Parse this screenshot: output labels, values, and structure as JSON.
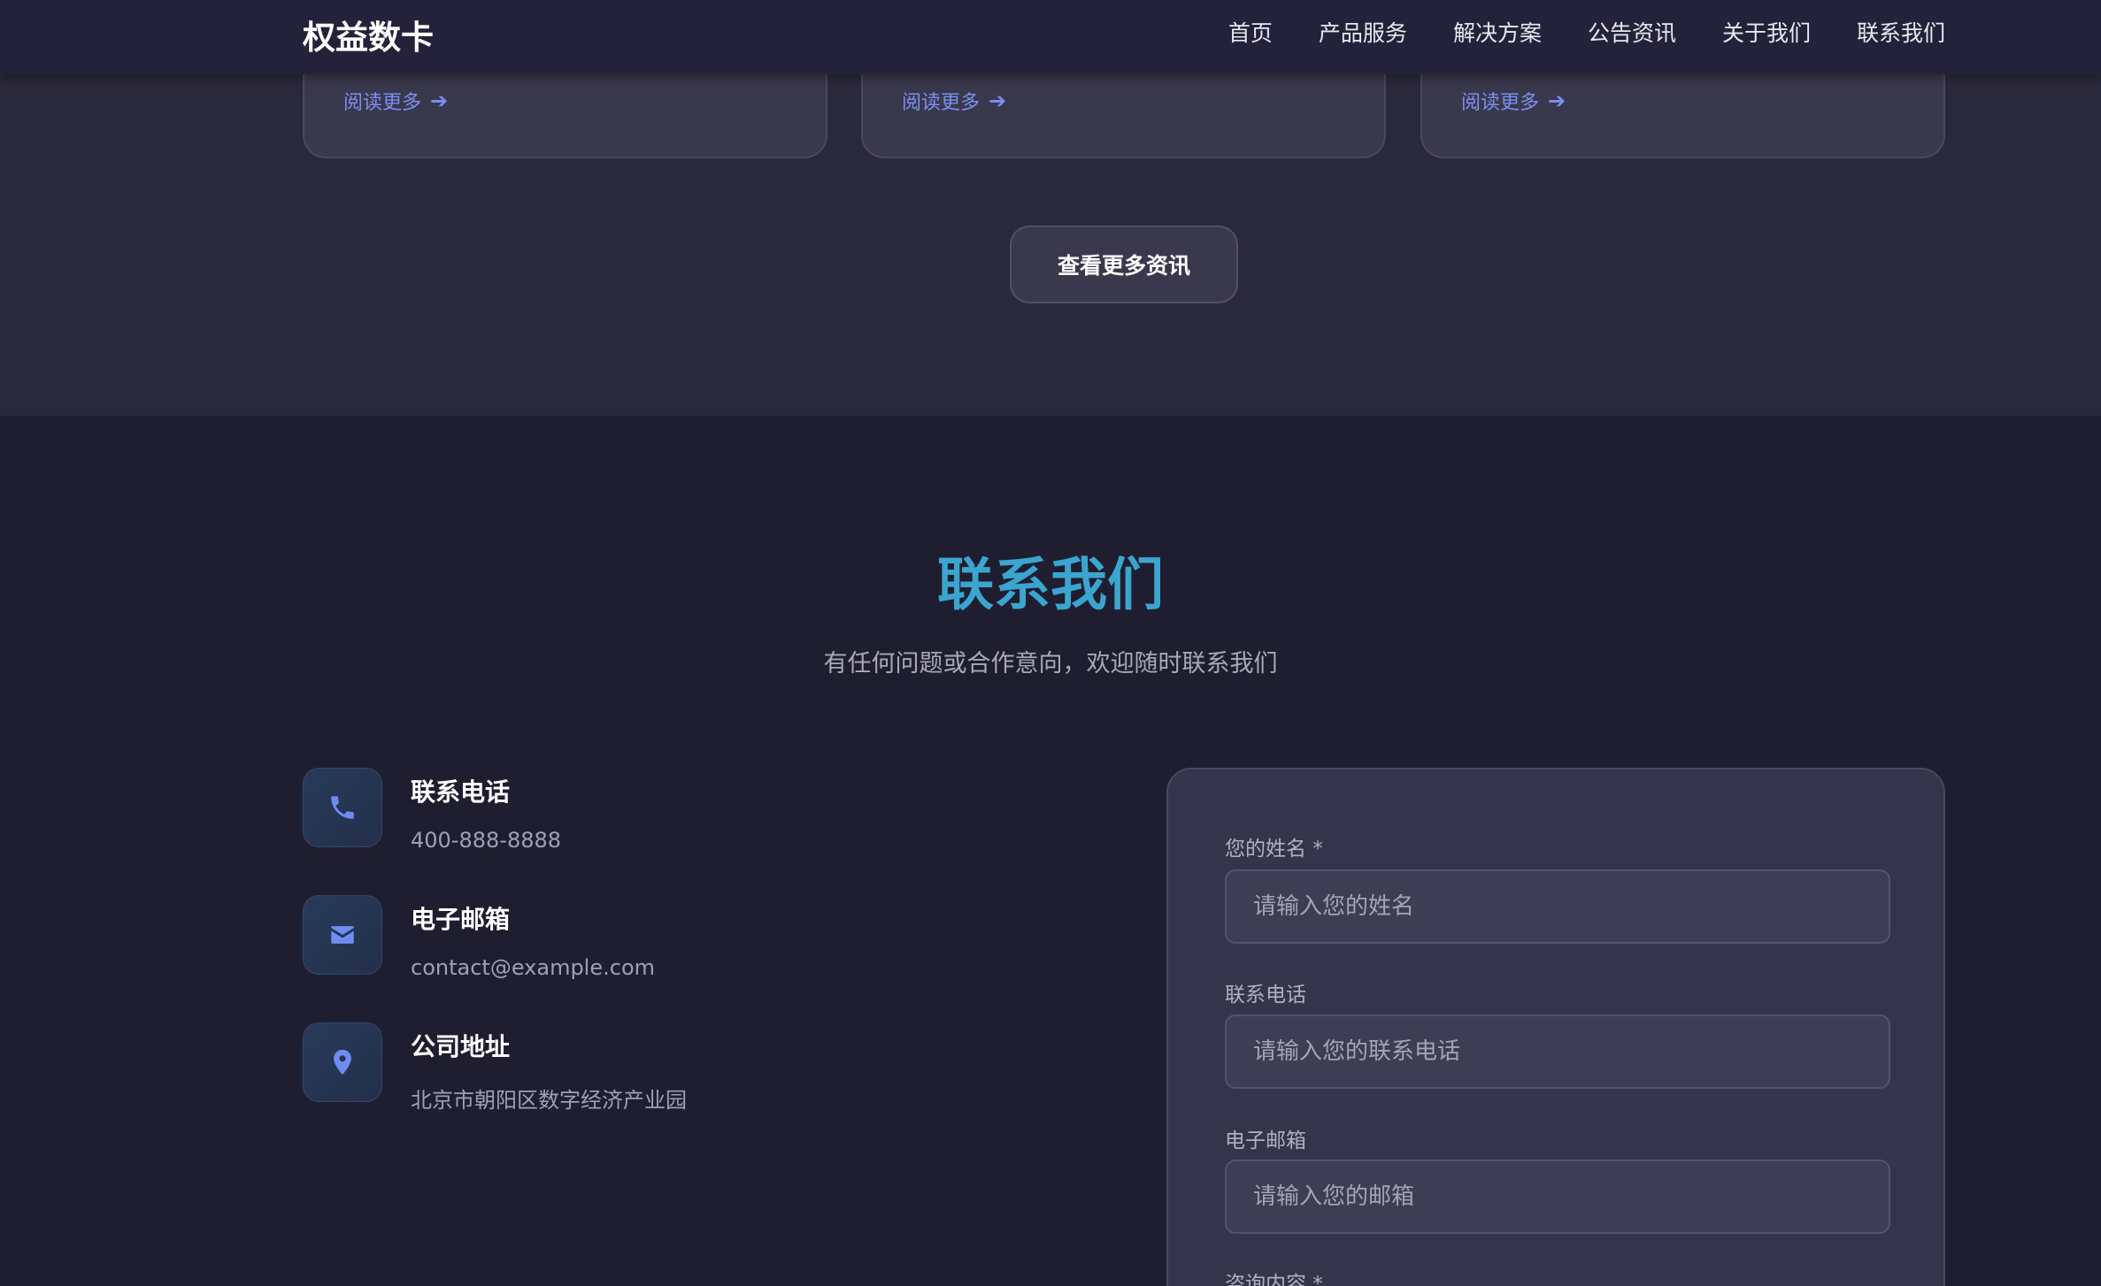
{
  "header": {
    "logo": "权益数卡",
    "nav": [
      "首页",
      "产品服务",
      "解决方案",
      "公告资讯",
      "关于我们",
      "联系我们"
    ]
  },
  "news": {
    "read_more": "阅读更多",
    "more_button": "查看更多资讯"
  },
  "contact": {
    "title": "联系我们",
    "subtitle": "有任何问题或合作意向，欢迎随时联系我们",
    "phone": {
      "label": "联系电话",
      "value": "400-888-8888",
      "icon": "phone-icon"
    },
    "email": {
      "label": "电子邮箱",
      "value": "contact@example.com",
      "icon": "envelope-icon"
    },
    "address": {
      "label": "公司地址",
      "value": "北京市朝阳区数字经济产业园",
      "icon": "map-pin-icon"
    }
  },
  "form": {
    "name_label": "您的姓名 *",
    "name_placeholder": "请输入您的姓名",
    "phone_label": "联系电话",
    "phone_placeholder": "请输入您的联系电话",
    "email_label": "电子邮箱",
    "email_placeholder": "请输入您的邮箱",
    "message_label": "咨询内容 *"
  },
  "colors": {
    "accent": "#3aa6d0",
    "link": "#7a8ff0",
    "background": "#1f1e30"
  }
}
